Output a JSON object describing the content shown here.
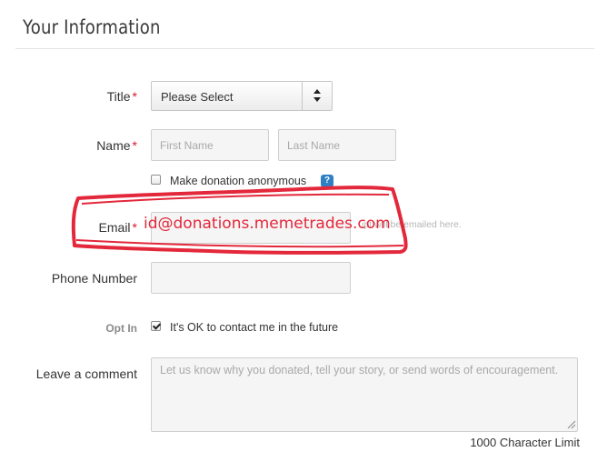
{
  "section": {
    "title": "Your Information"
  },
  "form": {
    "title": {
      "label": "Title",
      "required_mark": "*",
      "selected": "Please Select"
    },
    "name": {
      "label": "Name",
      "required_mark": "*",
      "first_placeholder": "First Name",
      "last_placeholder": "Last Name",
      "first_value": "",
      "last_value": ""
    },
    "anonymous": {
      "label": "Make donation anonymous",
      "checked": false,
      "help_icon": "question-icon",
      "help_glyph": "?"
    },
    "email": {
      "label": "Email",
      "required_mark": "*",
      "value": "",
      "hint": "ipt will be emailed here.",
      "overlay_text": "id@donations.memetrades.com"
    },
    "phone": {
      "label": "Phone Number",
      "value": ""
    },
    "opt_in": {
      "label": "Opt In",
      "checkbox_label": "It's OK to contact me in the future",
      "checked": true
    },
    "comment": {
      "label": "Leave a comment",
      "placeholder": "Let us know why you donated, tell your story, or send words of encouragement.",
      "value": "",
      "char_limit": "1000 Character Limit"
    }
  },
  "colors": {
    "required": "#d9152b",
    "annotation": "#e3283b",
    "help_icon": "#2f7fc4"
  }
}
